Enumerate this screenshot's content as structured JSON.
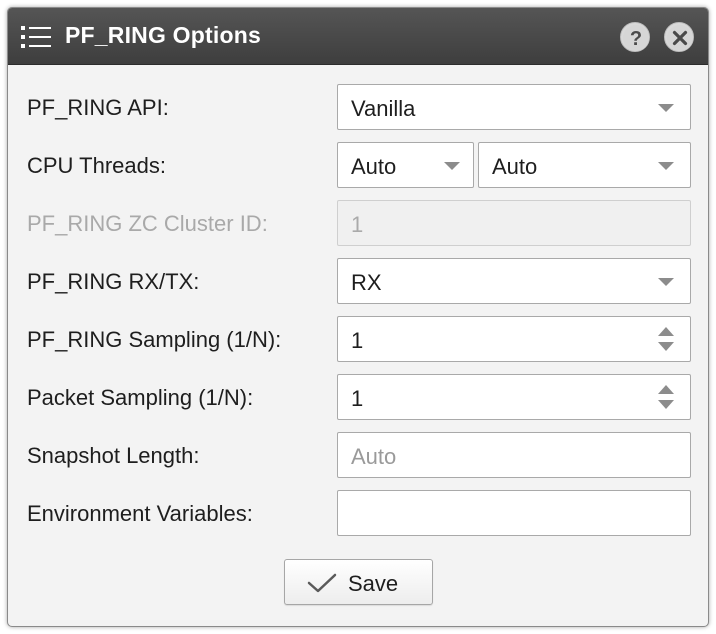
{
  "window": {
    "title": "PF_RING Options",
    "title_icon": "list-icon",
    "help_icon": "help-icon",
    "close_icon": "close-icon"
  },
  "form": {
    "api": {
      "label": "PF_RING API:",
      "value": "Vanilla"
    },
    "cpu_threads": {
      "label": "CPU Threads:",
      "value1": "Auto",
      "value2": "Auto"
    },
    "zc_cluster": {
      "label": "PF_RING ZC Cluster ID:",
      "value": "1",
      "disabled": true
    },
    "rxtx": {
      "label": "PF_RING RX/TX:",
      "value": "RX"
    },
    "pf_sampling": {
      "label": "PF_RING Sampling (1/N):",
      "value": "1"
    },
    "packet_sampling": {
      "label": "Packet Sampling (1/N):",
      "value": "1"
    },
    "snapshot_length": {
      "label": "Snapshot Length:",
      "value": "",
      "placeholder": "Auto"
    },
    "env_vars": {
      "label": "Environment Variables:",
      "value": ""
    }
  },
  "actions": {
    "save_label": "Save",
    "save_icon": "checkmark-icon"
  },
  "colors": {
    "titlebar": "#464646",
    "dialog_bg": "#f3f3f3",
    "field_border": "#a9a9a9",
    "disabled_text": "#a9a9a9"
  }
}
